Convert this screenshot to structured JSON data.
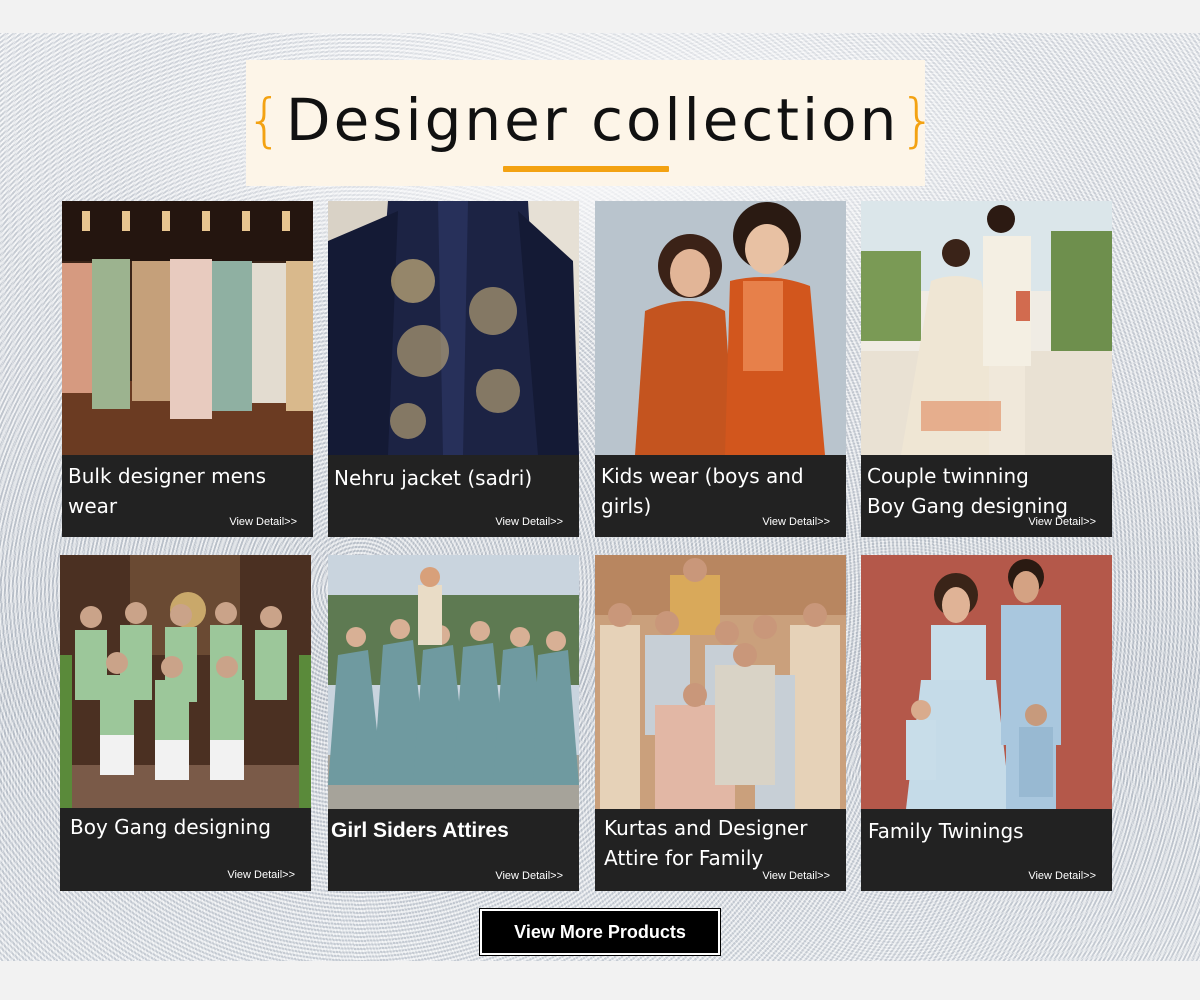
{
  "section": {
    "title": "Designer collection",
    "brace_open": "{",
    "brace_close": "}",
    "accent_color": "#f3a212"
  },
  "cards": [
    {
      "title": "Bulk designer mens wear",
      "detail": "View Detail>>"
    },
    {
      "title": "Nehru jacket (sadri)",
      "detail": "View Detail>>"
    },
    {
      "title": "Kids wear (boys and girls)",
      "detail": "View Detail>>"
    },
    {
      "title": "Couple twinning\nBoy Gang designing",
      "detail": "View Detail>>"
    },
    {
      "title": "Boy Gang designing",
      "detail": "View Detail>>"
    },
    {
      "title": "Girl Siders Attires",
      "detail": "View Detail>>"
    },
    {
      "title": "Kurtas and Designer Attire for Family",
      "detail": "View Detail>>"
    },
    {
      "title": "Family Twinings",
      "detail": "View Detail>>"
    }
  ],
  "cta": {
    "label": "View More Products"
  }
}
